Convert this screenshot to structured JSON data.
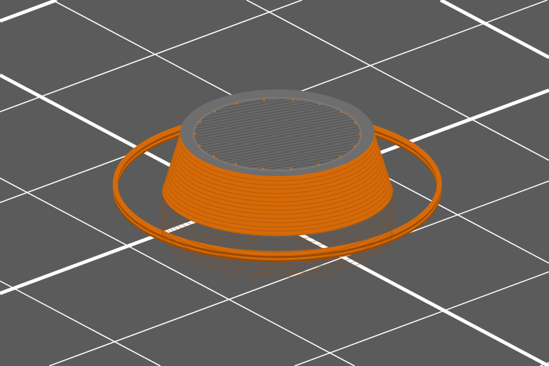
{
  "scene": {
    "colors": {
      "bed": "#5b5b5b",
      "grid": "#ffffff",
      "extrusion": "#d66a08",
      "extrusion_dark": "#9a4a05",
      "top_surface": "#6e6e6e",
      "top_lines": "#555555"
    }
  }
}
